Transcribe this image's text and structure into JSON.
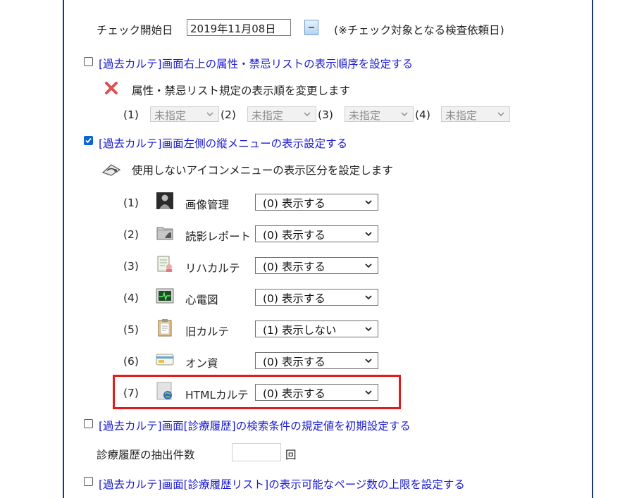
{
  "top": {
    "start_label": "チェック開始日",
    "start_value": "2019年11月08日",
    "start_note": "(※チェック対象となる検査依頼日)"
  },
  "section1": {
    "label": "[過去カルテ]画面右上の属性・禁忌リストの表示順序を設定する",
    "checked": false,
    "desc": "属性・禁忌リスト規定の表示順を変更します",
    "slots": [
      {
        "num": "(1)",
        "value": "未指定"
      },
      {
        "num": "(2)",
        "value": "未指定"
      },
      {
        "num": "(3)",
        "value": "未指定"
      },
      {
        "num": "(4)",
        "value": "未指定"
      }
    ]
  },
  "section2": {
    "label": "[過去カルテ]画面左側の縦メニューの表示設定する",
    "checked": true,
    "desc": "使用しないアイコンメニューの表示区分を設定します",
    "rows": [
      {
        "num": "(1)",
        "name": "画像管理",
        "icon": "image-management-icon",
        "value": "(0) 表示する"
      },
      {
        "num": "(2)",
        "name": "読影レポート",
        "icon": "reading-report-icon",
        "value": "(0) 表示する"
      },
      {
        "num": "(3)",
        "name": "リハカルテ",
        "icon": "rehab-chart-icon",
        "value": "(0) 表示する"
      },
      {
        "num": "(4)",
        "name": "心電図",
        "icon": "ecg-icon",
        "value": "(0) 表示する"
      },
      {
        "num": "(5)",
        "name": "旧カルテ",
        "icon": "old-chart-icon",
        "value": "(1) 表示しない"
      },
      {
        "num": "(6)",
        "name": "オン資",
        "icon": "online-qualification-icon",
        "value": "(0) 表示する"
      },
      {
        "num": "(7)",
        "name": "HTMLカルテ",
        "icon": "html-chart-icon",
        "value": "(0) 表示する"
      }
    ]
  },
  "section3": {
    "label": "[過去カルテ]画面[診療履歴]の検索条件の規定値を初期設定する",
    "checked": false,
    "count_label": "診療履歴の抽出件数",
    "count_value": "",
    "count_unit": "回"
  },
  "section4": {
    "label": "[過去カルテ]画面[診療履歴リスト]の表示可能なページ数の上限を設定する",
    "checked": false
  },
  "colors": {
    "link": "#1a1ad0",
    "highlight": "#e21c1c",
    "frame": "#1c3a78",
    "checkbox": "#0b65d8"
  }
}
